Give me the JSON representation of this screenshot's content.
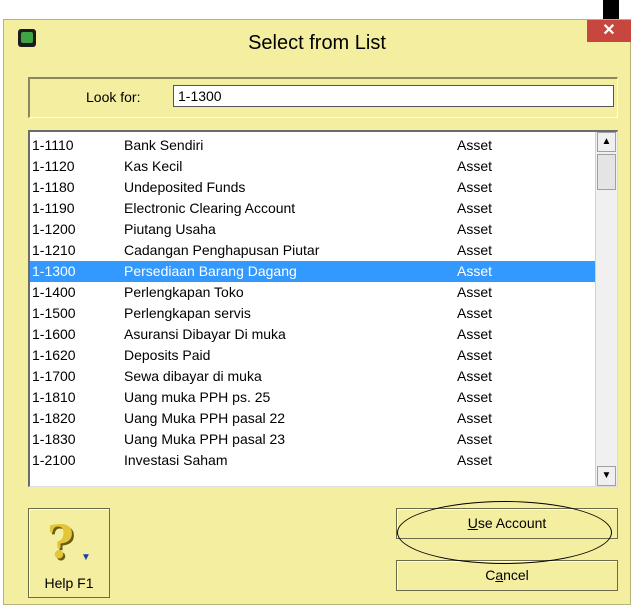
{
  "window": {
    "title": "Select from List",
    "close_icon": "close-icon",
    "app_icon": "app-icon"
  },
  "search": {
    "label": "Look for:",
    "value": "1-1300"
  },
  "accounts": [
    {
      "code": "1-1110",
      "name": "Bank Sendiri",
      "type": "Asset"
    },
    {
      "code": "1-1120",
      "name": "Kas Kecil",
      "type": "Asset"
    },
    {
      "code": "1-1180",
      "name": "Undeposited Funds",
      "type": "Asset"
    },
    {
      "code": "1-1190",
      "name": "Electronic Clearing Account",
      "type": "Asset"
    },
    {
      "code": "1-1200",
      "name": "Piutang Usaha",
      "type": "Asset"
    },
    {
      "code": "1-1210",
      "name": "Cadangan Penghapusan Piutar",
      "type": "Asset"
    },
    {
      "code": "1-1300",
      "name": "Persediaan Barang Dagang",
      "type": "Asset"
    },
    {
      "code": "1-1400",
      "name": "Perlengkapan Toko",
      "type": "Asset"
    },
    {
      "code": "1-1500",
      "name": "Perlengkapan servis",
      "type": "Asset"
    },
    {
      "code": "1-1600",
      "name": "Asuransi Dibayar Di muka",
      "type": "Asset"
    },
    {
      "code": "1-1620",
      "name": "Deposits Paid",
      "type": "Asset"
    },
    {
      "code": "1-1700",
      "name": "Sewa dibayar di muka",
      "type": "Asset"
    },
    {
      "code": "1-1810",
      "name": "Uang muka PPH ps. 25",
      "type": "Asset"
    },
    {
      "code": "1-1820",
      "name": "Uang Muka PPH pasal 22",
      "type": "Asset"
    },
    {
      "code": "1-1830",
      "name": "Uang Muka PPH pasal 23",
      "type": "Asset"
    },
    {
      "code": "1-2100",
      "name": "Investasi Saham",
      "type": "Asset"
    }
  ],
  "selected_code": "1-1300",
  "buttons": {
    "help_label": "Help F1",
    "use_account_key": "U",
    "use_account_rest": "se Account",
    "cancel_pre": "C",
    "cancel_key": "a",
    "cancel_rest": "ncel"
  },
  "colors": {
    "window_bg": "#f3eea0",
    "selection": "#3399ff",
    "close_button": "#c7463d"
  }
}
